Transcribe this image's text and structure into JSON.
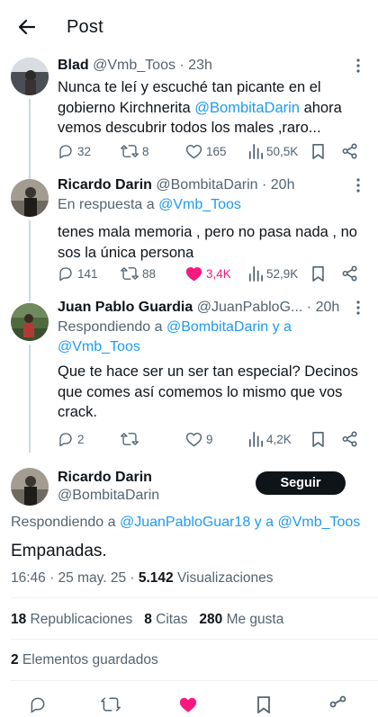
{
  "header": {
    "title": "Post"
  },
  "thread": [
    {
      "name": "Blad",
      "handle": "@Vmb_Toos · 23h",
      "text_pre": "Nunca te leí y escuché tan picante en el gobierno Kirchnerita ",
      "text_mention": "@BombitaDarin",
      "text_post": " ahora vemos descubrir todos los males ,raro...",
      "replies": "32",
      "reposts": "8",
      "likes": "165",
      "views": "50,5K"
    },
    {
      "name": "Ricardo Darin",
      "handle": "@BombitaDarin · 20h",
      "reply_prefix": "En respuesta a ",
      "reply_target": "@Vmb_Toos",
      "text": "tenes mala memoria , pero no pasa nada , no sos la única persona",
      "replies": "141",
      "reposts": "88",
      "likes": "3,4K",
      "views": "52,9K"
    },
    {
      "name": "Juan Pablo Guardia",
      "handle": "@JuanPabloG... · 20h",
      "reply_prefix": "Respondiendo a ",
      "reply_target": "@BombitaDarin y a @Vmb_Toos",
      "text": "Que te hace ser un ser tan especial? Decinos que comes así comemos lo mismo que vos crack.",
      "replies": "2",
      "reposts": "",
      "likes": "9",
      "views": "4,2K"
    }
  ],
  "main_post": {
    "name": "Ricardo Darin",
    "handle": "@BombitaDarin",
    "follow_label": "Seguir",
    "reply_prefix": "Respondiendo a ",
    "reply_target": "@JuanPabloGuar18 y a @Vmb_Toos",
    "text": "Empanadas.",
    "time": "16:46 · 25 may. 25 · ",
    "views_count": "5.142",
    "views_label": " Visualizaciones",
    "reposts_count": "18",
    "reposts_label": " Republicaciones",
    "quotes_count": "8",
    "quotes_label": " Citas",
    "likes_count": "280",
    "likes_label": " Me gusta",
    "saved_count": "2",
    "saved_label": " Elementos guardados"
  },
  "colors": {
    "link": "#1d9bf0",
    "like": "#f91880",
    "secondary": "#536471",
    "primary": "#0f1419"
  },
  "icons": [
    "back-arrow-icon",
    "more-icon",
    "reply-icon",
    "repost-icon",
    "like-icon",
    "views-icon",
    "bookmark-icon",
    "share-icon"
  ]
}
